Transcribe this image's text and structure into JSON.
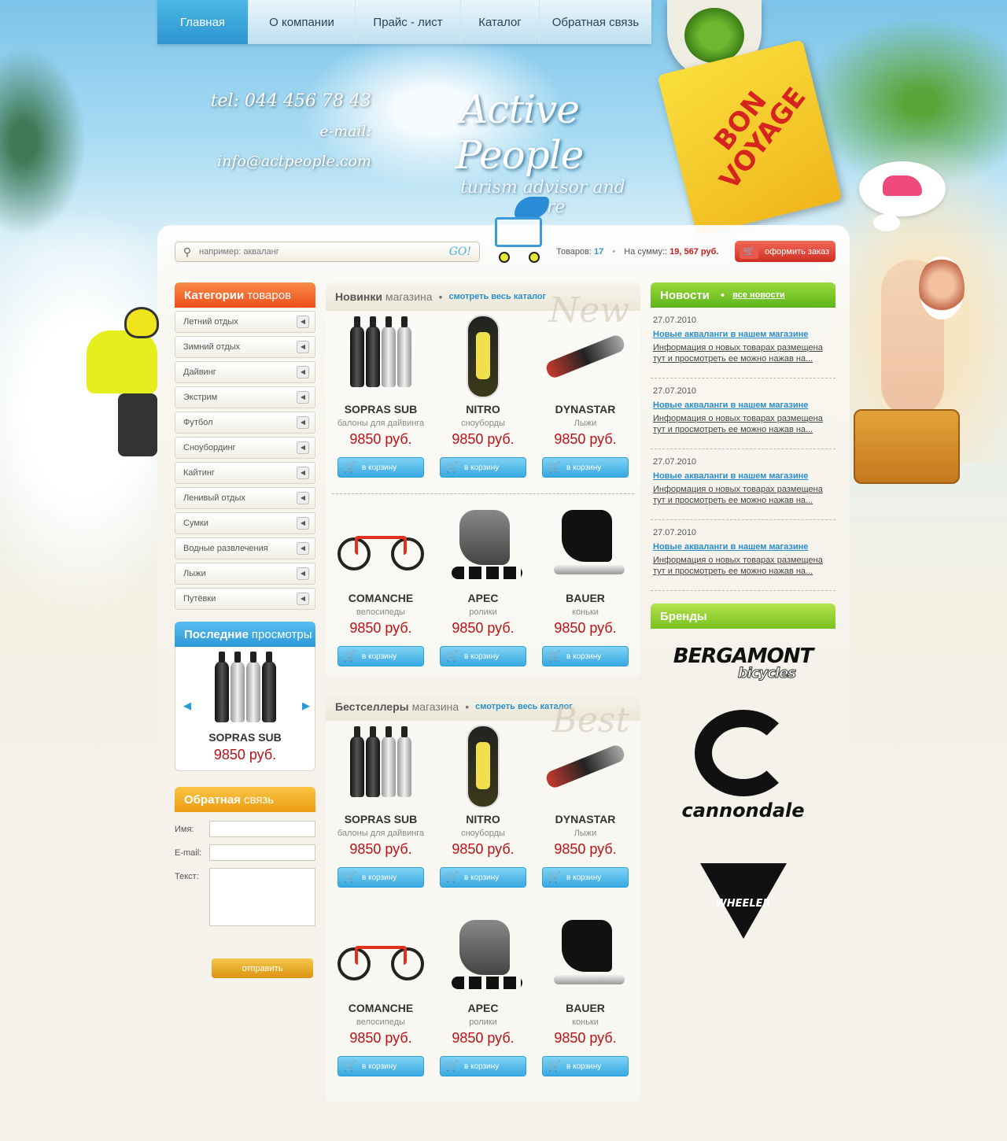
{
  "nav": [
    "Главная",
    "О компании",
    "Прайс - лист",
    "Каталог",
    "Обратная связь"
  ],
  "header": {
    "phone": "tel: 044 456 78 43",
    "email": "e-mail: info@actpeople.com",
    "logo_name": "Active People",
    "logo_tagline": "turism advisor and store",
    "tag_text": "BON VOYAGE"
  },
  "search": {
    "placeholder": "например: акваланг",
    "go_label": "GO!"
  },
  "cart": {
    "items_label": "Товаров:",
    "items_count": "17",
    "sum_label": "На сумму::",
    "sum_value": "19, 567 руб.",
    "order_label": "оформить заказ"
  },
  "categories": {
    "title_bold": "Категории",
    "title_rest": "товаров",
    "items": [
      "Летний отдых",
      "Зимний отдых",
      "Дайвинг",
      "Экстрим",
      "Футбол",
      "Сноубординг",
      "Кайтинг",
      "Ленивый отдых",
      "Сумки",
      "Водные развлечения",
      "Лыжи",
      "Путёвки"
    ]
  },
  "recent": {
    "title_bold": "Последние",
    "title_rest": "просмотры",
    "name": "SOPRAS SUB",
    "price": "9850 руб."
  },
  "feedback": {
    "title_bold": "Обратная",
    "title_rest": "связь",
    "name_label": "Имя:",
    "email_label": "E-mail:",
    "text_label": "Текст:",
    "send_label": "отправить"
  },
  "new_section": {
    "title_bold": "Новинки",
    "title_rest": "магазина",
    "link": "смотреть весь каталог",
    "watermark": "New",
    "products": [
      {
        "name": "SOPRAS SUB",
        "category": "балоны для дайвинга",
        "price": "9850 руб.",
        "button": "в корзину"
      },
      {
        "name": "NITRO",
        "category": "сноуборды",
        "price": "9850 руб.",
        "button": "в корзину"
      },
      {
        "name": "DYNASTAR",
        "category": "Лыжи",
        "price": "9850 руб.",
        "button": "в корзину"
      },
      {
        "name": "COMANCHE",
        "category": "велосипеды",
        "price": "9850 руб.",
        "button": "в корзину"
      },
      {
        "name": "APEC",
        "category": "ролики",
        "price": "9850 руб.",
        "button": "в корзину"
      },
      {
        "name": "BAUER",
        "category": "коньки",
        "price": "9850 руб.",
        "button": "в корзину"
      }
    ]
  },
  "best_section": {
    "title_bold": "Бестселлеры",
    "title_rest": "магазина",
    "link": "смотреть весь каталог",
    "watermark": "Best",
    "products": [
      {
        "name": "SOPRAS SUB",
        "category": "балоны для дайвинга",
        "price": "9850 руб.",
        "button": "в корзину"
      },
      {
        "name": "NITRO",
        "category": "сноуборды",
        "price": "9850 руб.",
        "button": "в корзину"
      },
      {
        "name": "DYNASTAR",
        "category": "Лыжи",
        "price": "9850 руб.",
        "button": "в корзину"
      },
      {
        "name": "COMANCHE",
        "category": "велосипеды",
        "price": "9850 руб.",
        "button": "в корзину"
      },
      {
        "name": "APEC",
        "category": "ролики",
        "price": "9850 руб.",
        "button": "в корзину"
      },
      {
        "name": "BAUER",
        "category": "коньки",
        "price": "9850 руб.",
        "button": "в корзину"
      }
    ]
  },
  "news": {
    "title": "Новости",
    "all_link": "все новости",
    "items": [
      {
        "date": "27.07.2010",
        "title": "Новые акваланги в нашем магазине",
        "desc": "Информация о новых товарах размещена тут и просмотреть ее можно нажав на..."
      },
      {
        "date": "27.07.2010",
        "title": "Новые акваланги в нашем магазине",
        "desc": "Информация о новых товарах размещена тут и просмотреть ее можно нажав на..."
      },
      {
        "date": "27.07.2010",
        "title": "Новые акваланги в нашем магазине",
        "desc": "Информация о новых товарах размещена тут и просмотреть ее можно нажав на..."
      },
      {
        "date": "27.07.2010",
        "title": "Новые акваланги в нашем магазине",
        "desc": "Информация о новых товарах размещена тут и просмотреть ее можно нажав на..."
      }
    ]
  },
  "brands": {
    "title": "Бренды",
    "items": [
      "BERGAMONT",
      "bicycles",
      "cannondale",
      "WHEELER"
    ]
  },
  "colors": {
    "accent_blue": "#2d98d8",
    "accent_orange": "#ec4f1b",
    "accent_green": "#5cb519",
    "price_red": "#bb1216"
  }
}
